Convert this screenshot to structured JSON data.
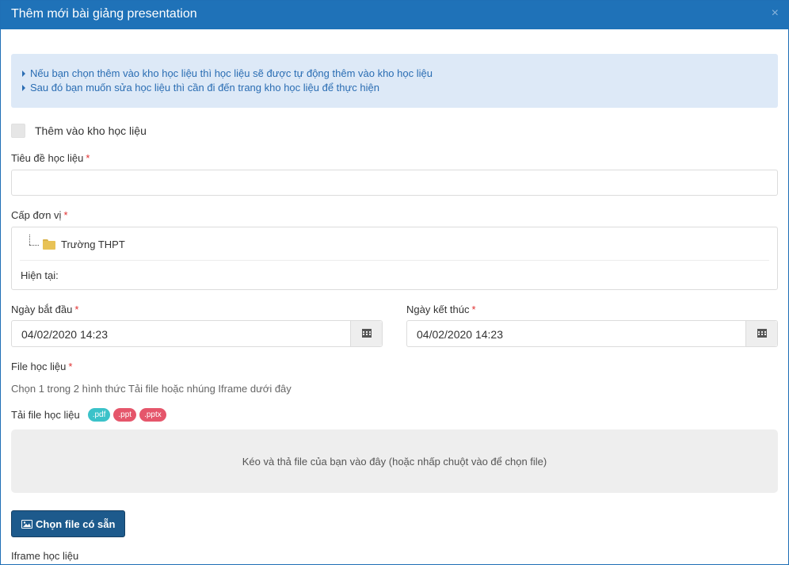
{
  "modal": {
    "title": "Thêm mới bài giảng presentation",
    "close": "×"
  },
  "info": {
    "lines": [
      "Nếu bạn chọn thêm vào kho học liệu thì học liệu sẽ được tự động thêm vào kho học liệu",
      "Sau đó bạn muốn sửa học liệu thì cần đi đến trang kho học liệu để thực hiện"
    ]
  },
  "form": {
    "add_to_library_label": "Thêm vào kho học liệu",
    "add_to_library_checked": false,
    "title_label": "Tiêu đề học liệu",
    "title_value": "",
    "unit_label": "Cấp đơn vị",
    "unit_tree_item": "Trường THPT",
    "current_label": "Hiện tại:",
    "start_label": "Ngày bắt đầu",
    "start_value": "04/02/2020 14:23",
    "end_label": "Ngày kết thúc",
    "end_value": "04/02/2020 14:23",
    "file_label": "File học liệu",
    "file_hint": "Chọn 1 trong 2 hình thức Tải file hoặc nhúng Iframe dưới đây",
    "upload_label": "Tải file học liệu",
    "badges": [
      ".pdf",
      ".ppt",
      ".pptx"
    ],
    "dropzone_text": "Kéo và thả file của bạn vào đây (hoặc nhấp chuột vào để chọn file)",
    "choose_button": "Chọn file có sẵn",
    "iframe_label": "Iframe học liệu",
    "required_mark": "*"
  },
  "colors": {
    "header": "#1f72b8",
    "primary_button": "#1d5a8c",
    "badge_pdf": "#3bc2c9",
    "badge_ppt": "#e5566b",
    "badge_pptx": "#e5566b",
    "required": "#e03131"
  },
  "icons": {
    "close": "close-icon",
    "calendar": "calendar-icon",
    "folder": "folder-icon",
    "image": "image-icon"
  }
}
